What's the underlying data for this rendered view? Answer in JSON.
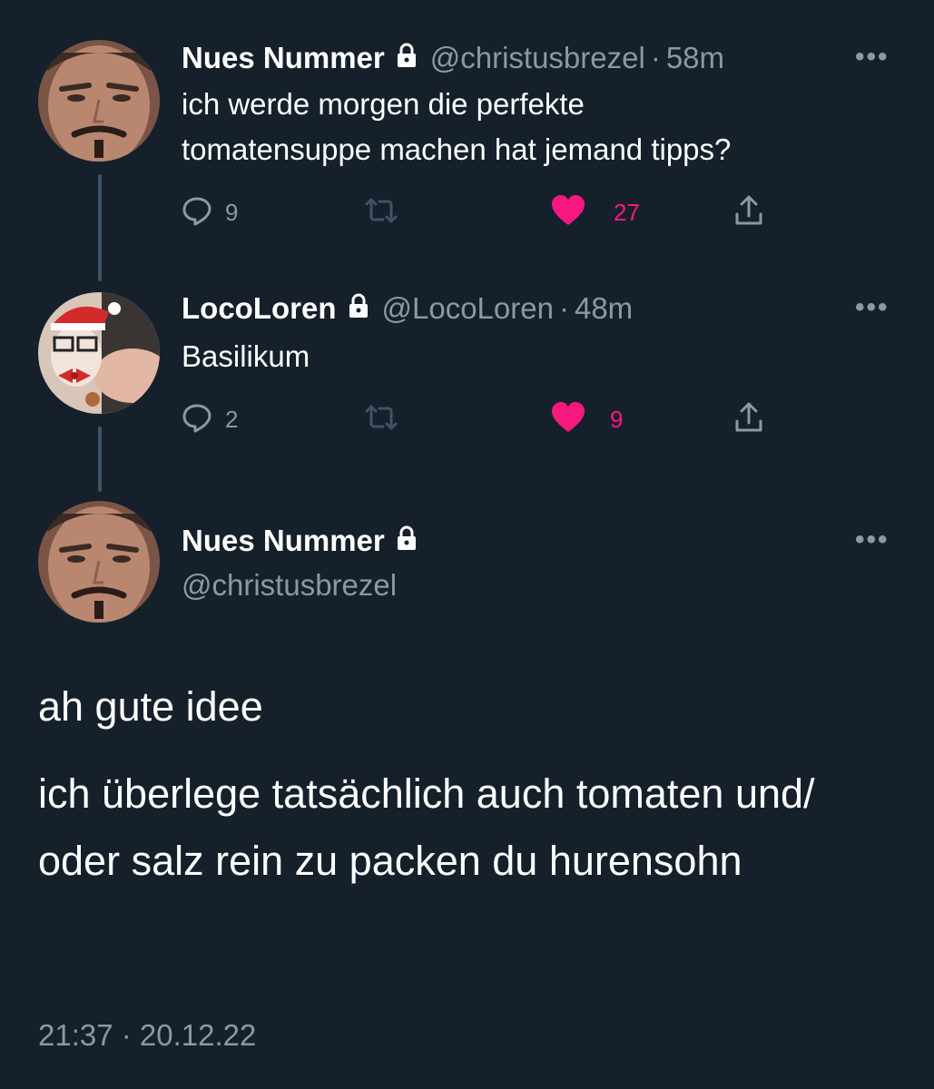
{
  "tweets": [
    {
      "name": "Nues Nummer",
      "handle": "@christusbrezel",
      "separator": "·",
      "time": "58m",
      "text_lines": [
        "ich werde morgen die perfekte",
        "tomatensuppe machen hat jemand tipps?"
      ],
      "replies": "9",
      "likes": "27",
      "more_label": "•••"
    },
    {
      "name": "LocoLoren",
      "handle": "@LocoLoren",
      "separator": "·",
      "time": "48m",
      "text": "Basilikum",
      "replies": "2",
      "likes": "9",
      "more_label": "•••"
    }
  ],
  "focused": {
    "name": "Nues Nummer",
    "handle": "@christusbrezel",
    "more_label": "•••",
    "paragraphs": [
      "ah gute idee",
      "ich überlege tatsächlich auch tomaten und/ oder salz rein zu packen du hurensohn"
    ],
    "timestamp": "21:37 · 20.12.22"
  },
  "icons": {
    "reply": "reply-bubble-icon",
    "retweet": "retweet-icon",
    "like": "heart-icon",
    "share": "share-icon",
    "lock": "lock-icon"
  },
  "colors": {
    "background": "#15202b",
    "secondary_text": "#8b98a5",
    "like": "#f91880",
    "thread_line": "#3d5466"
  }
}
